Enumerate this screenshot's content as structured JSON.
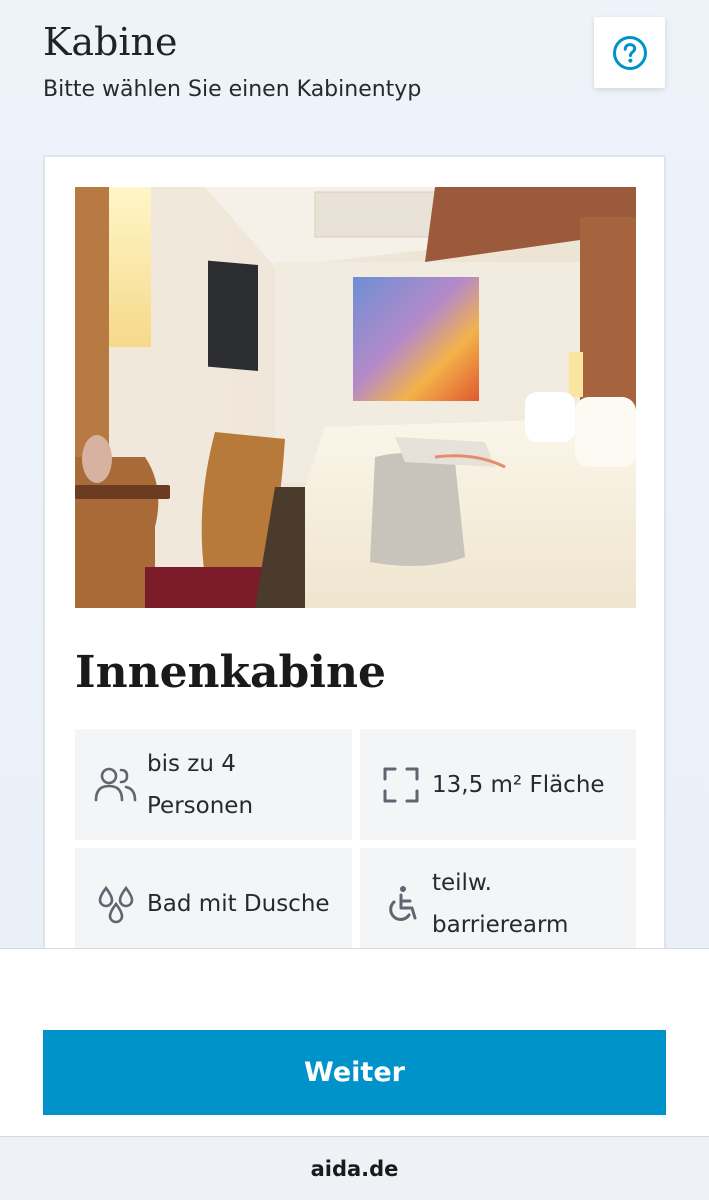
{
  "header": {
    "title": "Kabine",
    "subtitle": "Bitte wählen Sie einen Kabinentyp"
  },
  "help": {
    "icon": "question-circle-icon"
  },
  "card": {
    "cabin_name": "Innenkabine",
    "features": [
      {
        "icon": "persons-icon",
        "text_line1": "bis zu 4",
        "text_line2": "Personen"
      },
      {
        "icon": "area-frame-icon",
        "text_line1": "13,5 m² Fläche"
      },
      {
        "icon": "water-drops-icon",
        "text_line1": "Bad mit Dusche"
      },
      {
        "icon": "wheelchair-icon",
        "text_line1": "teilw.",
        "text_line2": "barrierearm"
      }
    ]
  },
  "footer": {
    "continue_label": "Weiter"
  },
  "browser": {
    "url": "aida.de"
  },
  "colors": {
    "accent": "#0093c9",
    "feature_bg": "#f4f5f7",
    "icon_gray": "#5f6672"
  }
}
